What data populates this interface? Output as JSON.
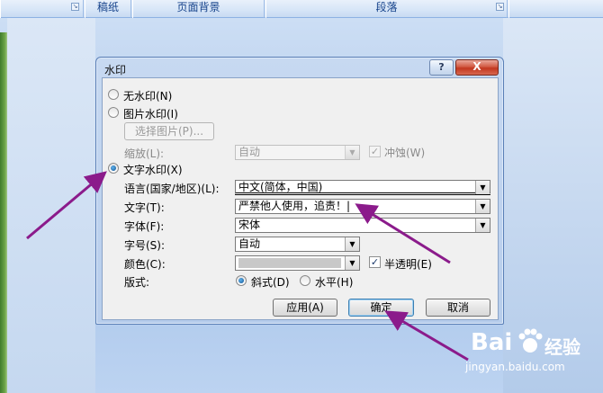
{
  "ribbon": {
    "group1_label": "稿纸",
    "group2_label": "页面背景",
    "group3_label": "段落"
  },
  "dialog": {
    "title": "水印",
    "help_label": "?",
    "close_label": "X",
    "no_watermark_label": "无水印(N)",
    "picture_watermark_label": "图片水印(I)",
    "select_picture_label": "选择图片(P)...",
    "scale_label": "缩放(L):",
    "scale_value": "自动",
    "washout_label": "冲蚀(W)",
    "text_watermark_label": "文字水印(X)",
    "language_label": "语言(国家/地区)(L):",
    "language_value": "中文(简体，中国)",
    "text_label": "文字(T):",
    "text_value": "严禁他人使用，追责！|",
    "font_label": "字体(F):",
    "font_value": "宋体",
    "size_label": "字号(S):",
    "size_value": "自动",
    "color_label": "颜色(C):",
    "semitransparent_label": "半透明(E)",
    "layout_label": "版式:",
    "diagonal_label": "斜式(D)",
    "horizontal_label": "水平(H)",
    "apply_label": "应用(A)",
    "ok_label": "确定",
    "cancel_label": "取消",
    "selected_option": "text_watermark",
    "selected_layout": "diagonal",
    "semitransparent_checked": true,
    "washout_checked": true
  },
  "watermark": {
    "brand": "Bai",
    "brand_cn": "经验",
    "url": "jingyan.baidu.com"
  },
  "colors": {
    "arrow": "#8b1b8b",
    "title_bar": "#c7d9f1",
    "panel": "#f0f0f0",
    "close_button": "#c2371f"
  }
}
